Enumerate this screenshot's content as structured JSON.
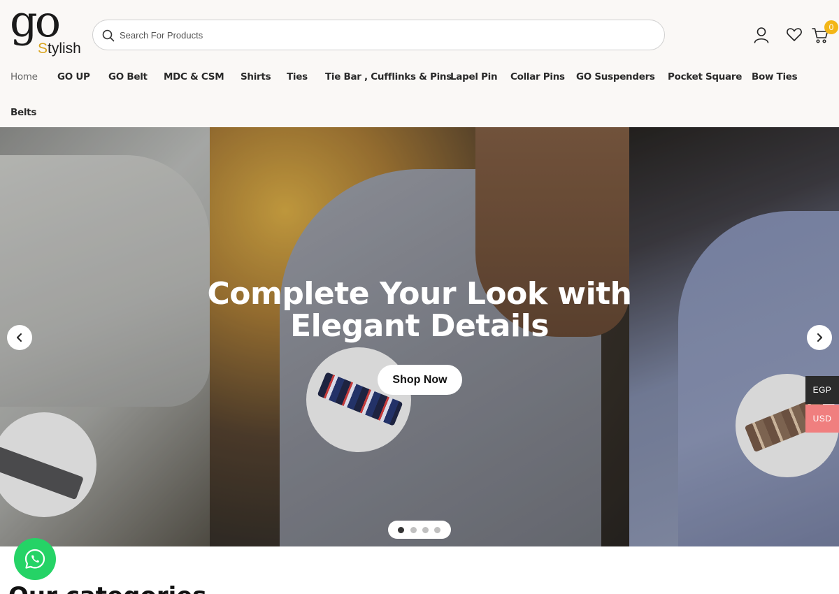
{
  "brand": {
    "logo_main": "go",
    "logo_sub_s": "S",
    "logo_sub_rest": "tylish"
  },
  "search": {
    "placeholder": "Search For Products"
  },
  "cart": {
    "count": "0"
  },
  "nav": {
    "items": [
      {
        "label": "Home",
        "active": true
      },
      {
        "label": "GO UP"
      },
      {
        "label": "GO Belt"
      },
      {
        "label": "MDC & CSM"
      },
      {
        "label": "Shirts"
      },
      {
        "label": "Ties"
      },
      {
        "label": "Tie Bar , Cufflinks & Pins"
      },
      {
        "label": "Lapel Pin"
      },
      {
        "label": "Collar Pins"
      },
      {
        "label": "GO Suspenders"
      },
      {
        "label": "Pocket Square"
      },
      {
        "label": "Bow Ties"
      },
      {
        "label": "Belts"
      }
    ]
  },
  "hero": {
    "title": "Complete Your Look with Elegant Details",
    "cta_label": "Shop Now",
    "slide_count": 4,
    "active_slide": 1
  },
  "currency": {
    "primary": "EGP",
    "secondary": "USD"
  },
  "section": {
    "title": "Our categories"
  },
  "colors": {
    "accent": "#f3b617",
    "whatsapp": "#25d366",
    "usd": "#f07f7f",
    "egp": "#2b2b2b"
  }
}
